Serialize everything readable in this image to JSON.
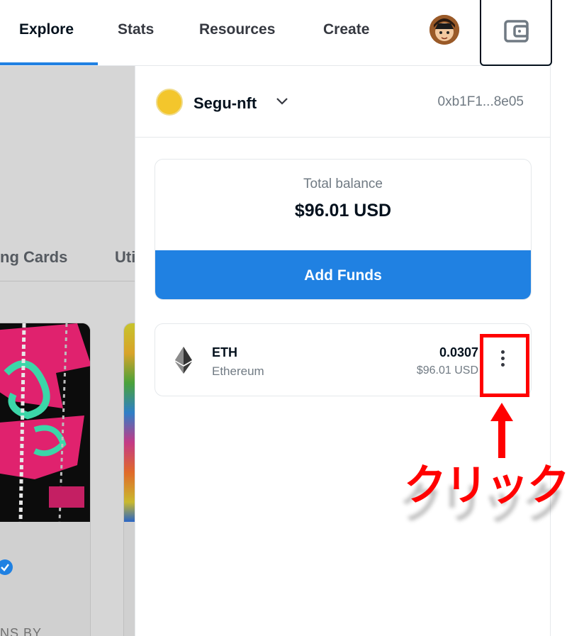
{
  "nav": {
    "items": [
      "Explore",
      "Stats",
      "Resources",
      "Create"
    ],
    "active_index": 0
  },
  "background": {
    "tabs": [
      "ng Cards",
      "Uti"
    ],
    "card_caption_fragment": "NS BY"
  },
  "wallet": {
    "account_name": "Segu-nft",
    "address": "0xb1F1...8e05",
    "balance_label": "Total balance",
    "balance_value": "$96.01 USD",
    "add_funds_label": "Add Funds",
    "tokens": [
      {
        "symbol": "ETH",
        "name": "Ethereum",
        "amount": "0.0307",
        "usd": "$96.01 USD"
      }
    ]
  },
  "annotation": {
    "label": "クリック",
    "color": "#ff0000"
  },
  "colors": {
    "accent": "#2081e2",
    "account_dot": "#f3c62c",
    "text_primary": "#04111d",
    "text_secondary": "#707a83"
  }
}
